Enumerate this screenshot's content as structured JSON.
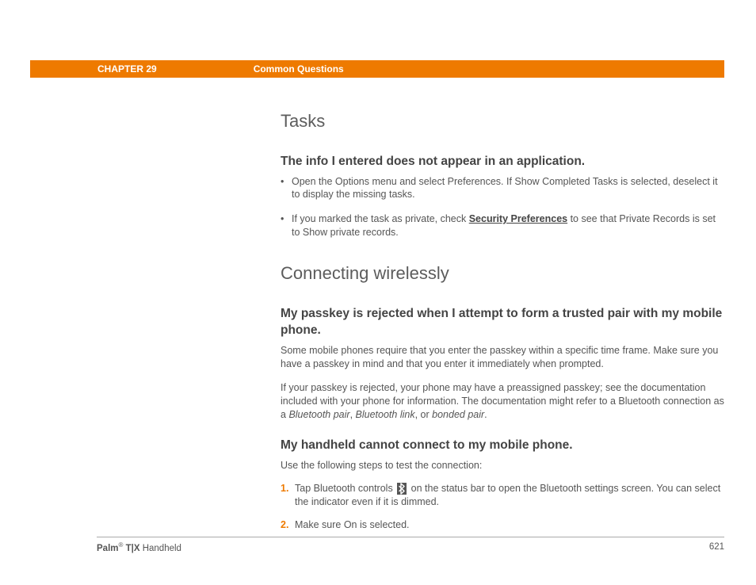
{
  "header": {
    "chapter": "CHAPTER 29",
    "section_name": "Common Questions"
  },
  "sections": {
    "tasks": {
      "title": "Tasks",
      "qa1": {
        "heading": "The info I entered does not appear in an application.",
        "bullet1": "Open the Options menu and select Preferences. If Show Completed Tasks is selected, deselect it to display the missing tasks.",
        "bullet2_pre": "If you marked the task as private, check ",
        "bullet2_link": "Security Preferences",
        "bullet2_post": " to see that Private Records is set to Show private records."
      }
    },
    "wireless": {
      "title": "Connecting wirelessly",
      "qa1": {
        "heading": "My passkey is rejected when I attempt to form a trusted pair with my mobile phone.",
        "p1": "Some mobile phones require that you enter the passkey within a specific time frame. Make sure you have a passkey in mind and that you enter it immediately when prompted.",
        "p2_pre": "If your passkey is rejected, your phone may have a preassigned passkey; see the documentation included with your phone for information. The documentation might refer to a Bluetooth connection as a ",
        "p2_i1": "Bluetooth pair",
        "p2_m1": ", ",
        "p2_i2": "Bluetooth link",
        "p2_m2": ", or ",
        "p2_i3": "bonded pair",
        "p2_post": "."
      },
      "qa2": {
        "heading": "My handheld cannot connect to my mobile phone.",
        "intro": "Use the following steps to test the connection:",
        "step1_pre": "Tap Bluetooth controls ",
        "step1_post": " on the status bar to open the Bluetooth settings screen. You can select the indicator even if it is dimmed.",
        "step2": "Make sure On is selected.",
        "n1": "1.",
        "n2": "2."
      }
    }
  },
  "footer": {
    "brand_bold": "Palm",
    "brand_reg": "®",
    "brand_model": " T|X",
    "brand_tail": " Handheld",
    "page": "621"
  }
}
